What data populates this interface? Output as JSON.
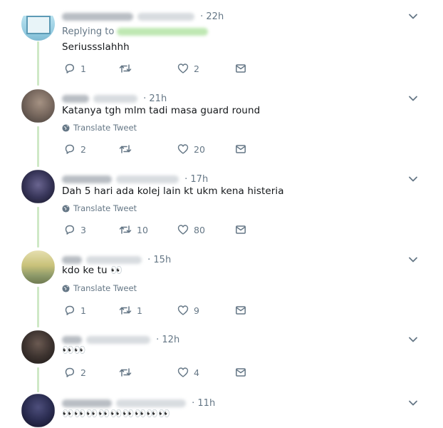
{
  "tweets": [
    {
      "time": "22h",
      "replying_to_label": "Replying to",
      "text": "Seriussslahhh",
      "translate": "",
      "reply_count": "1",
      "retweet_count": "",
      "like_count": "2",
      "avatar_colors": [
        "#9fd4e8",
        "#6aa9c4"
      ]
    },
    {
      "time": "21h",
      "replying_to_label": "",
      "text": "Katanya tgh mlm tadi masa guard round",
      "translate": "Translate Tweet",
      "reply_count": "2",
      "retweet_count": "",
      "like_count": "20",
      "avatar_colors": [
        "#8a7a6f",
        "#4d4540"
      ]
    },
    {
      "time": "17h",
      "replying_to_label": "",
      "text": "Dah 5 hari ada kolej lain kt ukm kena histeria",
      "translate": "Translate Tweet",
      "reply_count": "3",
      "retweet_count": "10",
      "like_count": "80",
      "avatar_colors": [
        "#3b3a5c",
        "#151526"
      ]
    },
    {
      "time": "15h",
      "replying_to_label": "",
      "text": "kdo ke tu 👀",
      "translate": "Translate Tweet",
      "reply_count": "1",
      "retweet_count": "1",
      "like_count": "9",
      "avatar_colors": [
        "#c9c27a",
        "#7e8a5c"
      ]
    },
    {
      "time": "12h",
      "replying_to_label": "",
      "text": "👀👀",
      "translate": "",
      "reply_count": "2",
      "retweet_count": "",
      "like_count": "4",
      "avatar_colors": [
        "#5a4a44",
        "#201b19"
      ]
    },
    {
      "time": "11h",
      "replying_to_label": "",
      "text": "👀👀👀👀👀👀👀👀👀",
      "translate": "",
      "reply_count": "",
      "retweet_count": "",
      "like_count": "",
      "avatar_colors": [
        "#2b2d52",
        "#111122"
      ]
    }
  ],
  "icons": {
    "reply": "reply-icon",
    "retweet": "retweet-icon",
    "like": "heart-icon",
    "message": "direct-message-icon",
    "translate": "globe-icon",
    "menu": "chevron-down-icon"
  },
  "colors": {
    "thread_line": "#cfe9c6",
    "muted": "#657786",
    "text": "#14171a"
  }
}
